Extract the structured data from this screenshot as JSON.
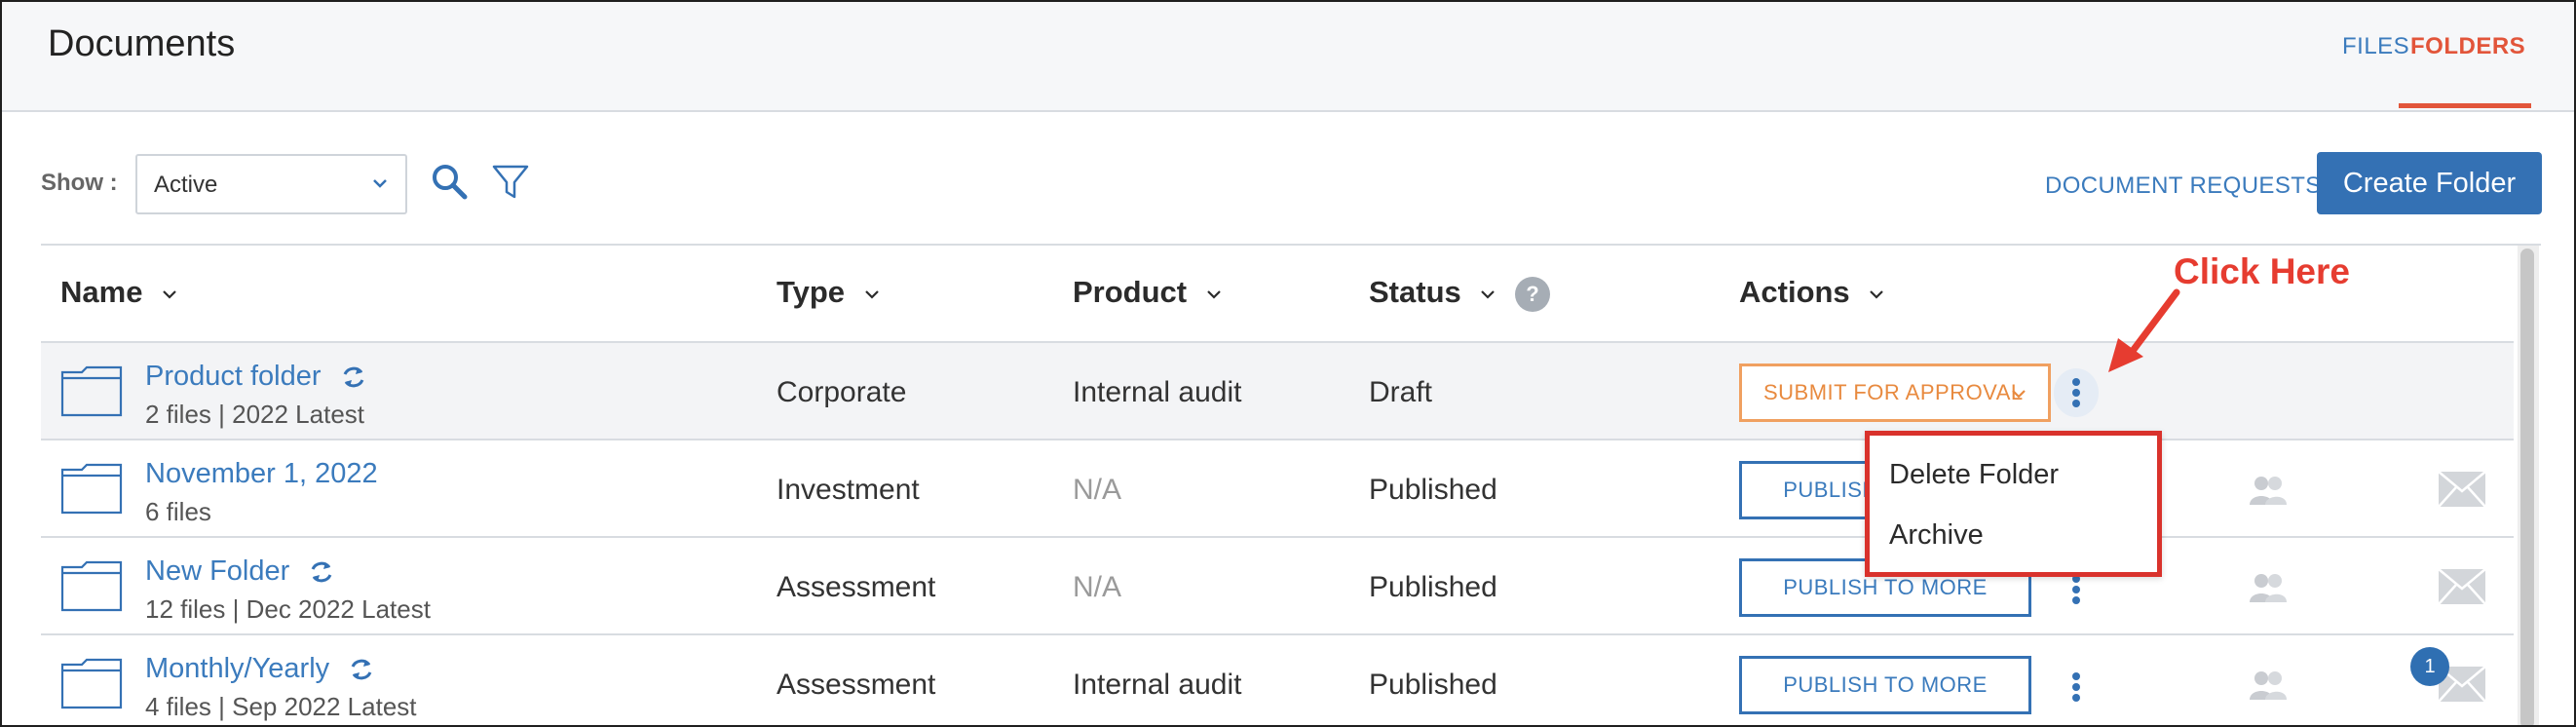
{
  "header": {
    "title": "Documents",
    "tabs": [
      {
        "label": "FILES",
        "active": false
      },
      {
        "label": "FOLDERS",
        "active": true
      }
    ]
  },
  "toolbar": {
    "show_label": "Show :",
    "show_value": "Active",
    "document_requests": "DOCUMENT REQUESTS",
    "create_folder": "Create Folder"
  },
  "table": {
    "columns": {
      "name": "Name",
      "type": "Type",
      "product": "Product",
      "status": "Status",
      "actions": "Actions",
      "status_help": "?"
    },
    "rows": [
      {
        "name": "Product folder",
        "meta": "2 files | 2022 Latest",
        "type": "Corporate",
        "product": "Internal audit",
        "status": "Draft",
        "action": "SUBMIT FOR APPROVAL"
      },
      {
        "name": "November 1, 2022",
        "meta": "6 files",
        "type": "Investment",
        "product": "N/A",
        "status": "Published",
        "action": "PUBLISH TO MORE"
      },
      {
        "name": "New Folder",
        "meta": "12 files | Dec 2022 Latest",
        "type": "Assessment",
        "product": "N/A",
        "status": "Published",
        "action": "PUBLISH TO MORE"
      },
      {
        "name": "Monthly/Yearly",
        "meta": "4 files | Sep 2022 Latest",
        "type": "Assessment",
        "product": "Internal audit",
        "status": "Published",
        "action": "PUBLISH TO MORE",
        "badge": "1"
      }
    ]
  },
  "menu": {
    "items": [
      "Delete Folder",
      "Archive"
    ]
  },
  "annotation": {
    "text": "Click Here"
  },
  "colors": {
    "accent": "#3471b4",
    "active_tab": "#e2553a",
    "submit_orange": "#e88a3f",
    "annotation_red": "#e63c30"
  },
  "icons": [
    "folder-icon",
    "sync-icon",
    "search-icon",
    "filter-icon",
    "chevron-down-icon",
    "kebab-icon",
    "users-icon",
    "mail-icon",
    "help-icon"
  ]
}
